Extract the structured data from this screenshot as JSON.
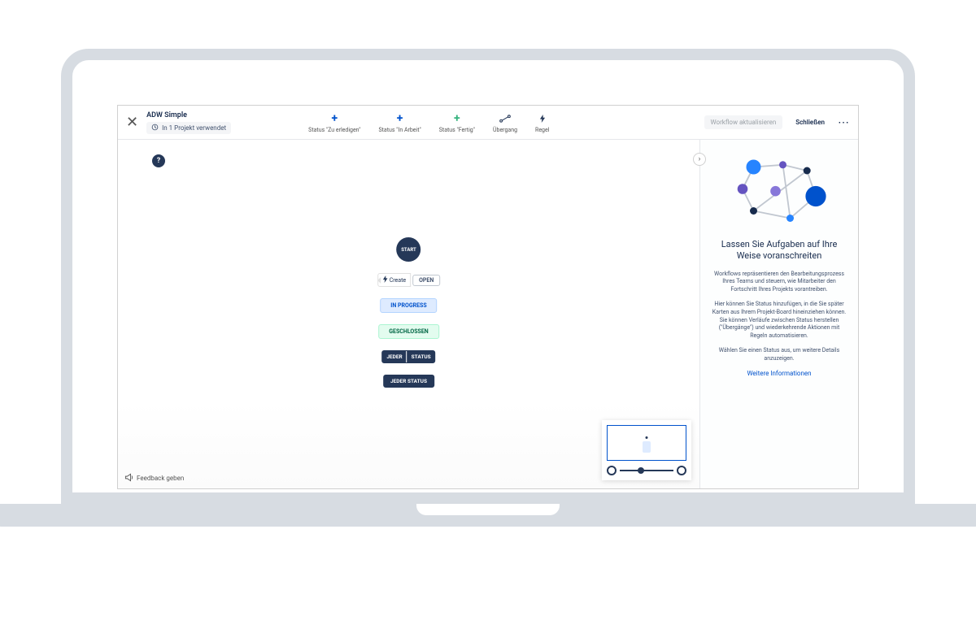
{
  "header": {
    "title": "ADW Simple",
    "project_chip": "In 1 Projekt verwendet",
    "update_btn": "Workflow aktualisieren",
    "close_btn": "Schließen"
  },
  "toolbar": {
    "todo": "Status \"Zu erledigen\"",
    "inprogress": "Status \"In Arbeit\"",
    "done": "Status \"Fertig\"",
    "transition": "Übergang",
    "rule": "Regel"
  },
  "flow": {
    "start": "START",
    "create_action": "Create",
    "open": "OPEN",
    "inprogress": "IN PROGRESS",
    "closed": "GESCHLOSSEN",
    "anystatus1_l": "JEDER",
    "anystatus1_r": "STATUS",
    "anystatus2": "JEDER STATUS"
  },
  "panel": {
    "title": "Lassen Sie Aufgaben auf Ihre Weise voranschreiten",
    "p1": "Workflows repräsentieren den Bearbeitungsprozess Ihres Teams und steuern, wie Mitarbeiter den Fortschritt Ihres Projekts vorantreiben.",
    "p2": "Hier können Sie Status hinzufügen, in die Sie später Karten aus Ihrem Projekt-Board hineinziehen können. Sie können Verläufe zwischen Status herstellen (\"Übergänge\") und wiederkehrende Aktionen mit Regeln automatisieren.",
    "p3": "Wählen Sie einen Status aus, um weitere Details anzuzeigen.",
    "link": "Weitere Informationen"
  },
  "feedback": "Feedback geben"
}
